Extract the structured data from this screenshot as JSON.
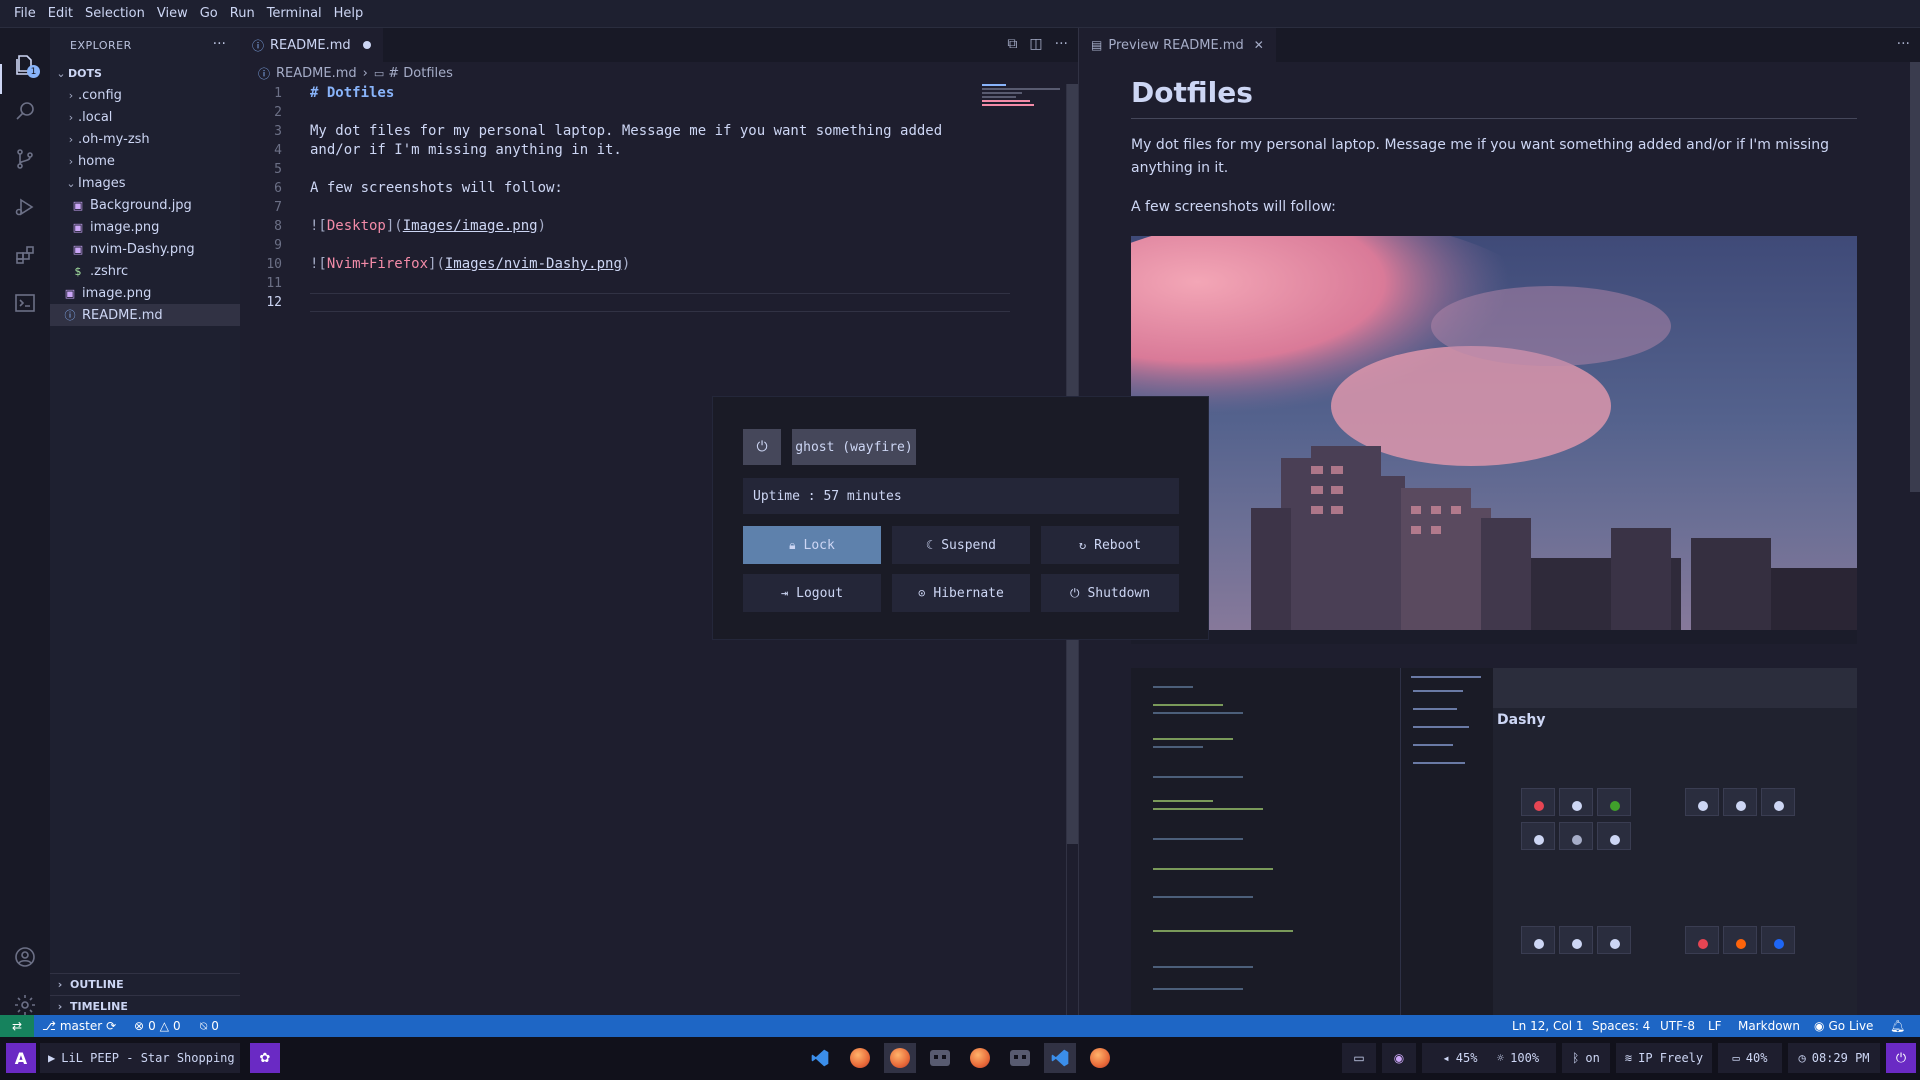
{
  "menu": [
    "File",
    "Edit",
    "Selection",
    "View",
    "Go",
    "Run",
    "Terminal",
    "Help"
  ],
  "activity": {
    "explorer_badge": "1"
  },
  "sidebar": {
    "title": "EXPLORER",
    "root": "DOTS",
    "items": [
      {
        "label": ".config",
        "kind": "folder"
      },
      {
        "label": ".local",
        "kind": "folder"
      },
      {
        "label": ".oh-my-zsh",
        "kind": "folder"
      },
      {
        "label": "home",
        "kind": "folder"
      },
      {
        "label": "Images",
        "kind": "folder-open"
      },
      {
        "label": "Background.jpg",
        "kind": "image"
      },
      {
        "label": "image.png",
        "kind": "image"
      },
      {
        "label": "nvim-Dashy.png",
        "kind": "image"
      },
      {
        "label": ".zshrc",
        "kind": "shell"
      },
      {
        "label": "image.png",
        "kind": "image"
      },
      {
        "label": "README.md",
        "kind": "info"
      }
    ],
    "sections": [
      "OUTLINE",
      "TIMELINE"
    ]
  },
  "editor": {
    "tab_label": "README.md",
    "breadcrumb": {
      "file": "README.md",
      "symbol": "# Dotfiles"
    },
    "line_numbers": [
      "1",
      "2",
      "3",
      "4",
      "5",
      "6",
      "7",
      "8",
      "9",
      "10",
      "11",
      "12"
    ],
    "current_line": "12",
    "lines": {
      "l1": "# Dotfiles",
      "l3": "My dot files for my personal laptop. Message me if you want something added",
      "l4": "and/or if I'm missing anything in it.",
      "l6": "A few screenshots will follow:",
      "l8a": "![",
      "l8b": "Desktop",
      "l8c": "](",
      "l8d": "Images/image.png",
      "l8e": ")",
      "l10a": "![",
      "l10b": "Nvim+Firefox",
      "l10c": "](",
      "l10d": "Images/nvim-Dashy.png",
      "l10e": ")"
    }
  },
  "preview": {
    "tab_label": "Preview README.md",
    "heading": "Dotfiles",
    "paragraph1": "My dot files for my personal laptop. Message me if you want something added and/or if I'm missing anything in it.",
    "paragraph2": "A few screenshots will follow:",
    "image2_title": "Dashy"
  },
  "power_menu": {
    "host": "ghost (wayfire)",
    "uptime": "Uptime : 57 minutes",
    "buttons": [
      "Lock",
      "Suspend",
      "Reboot",
      "Logout",
      "Hibernate",
      "Shutdown"
    ],
    "selected": "Lock"
  },
  "statusbar": {
    "branch": "master",
    "errors": "0",
    "warnings": "0",
    "ports": "0",
    "position": "Ln 12, Col 1",
    "spaces": "Spaces: 4",
    "encoding": "UTF-8",
    "eol": "LF",
    "language": "Markdown",
    "golive": "Go Live"
  },
  "taskbar": {
    "media": "LiL PEEP - Star Shopping",
    "volume": "45%",
    "brightness": "100%",
    "bluetooth": "on",
    "network": "IP Freely",
    "battery": "40%",
    "clock": "08:29 PM"
  },
  "colors": {
    "accent": "#6a2ac4",
    "statusbar": "#1e66c5",
    "power_selected": "#5e81ac"
  }
}
